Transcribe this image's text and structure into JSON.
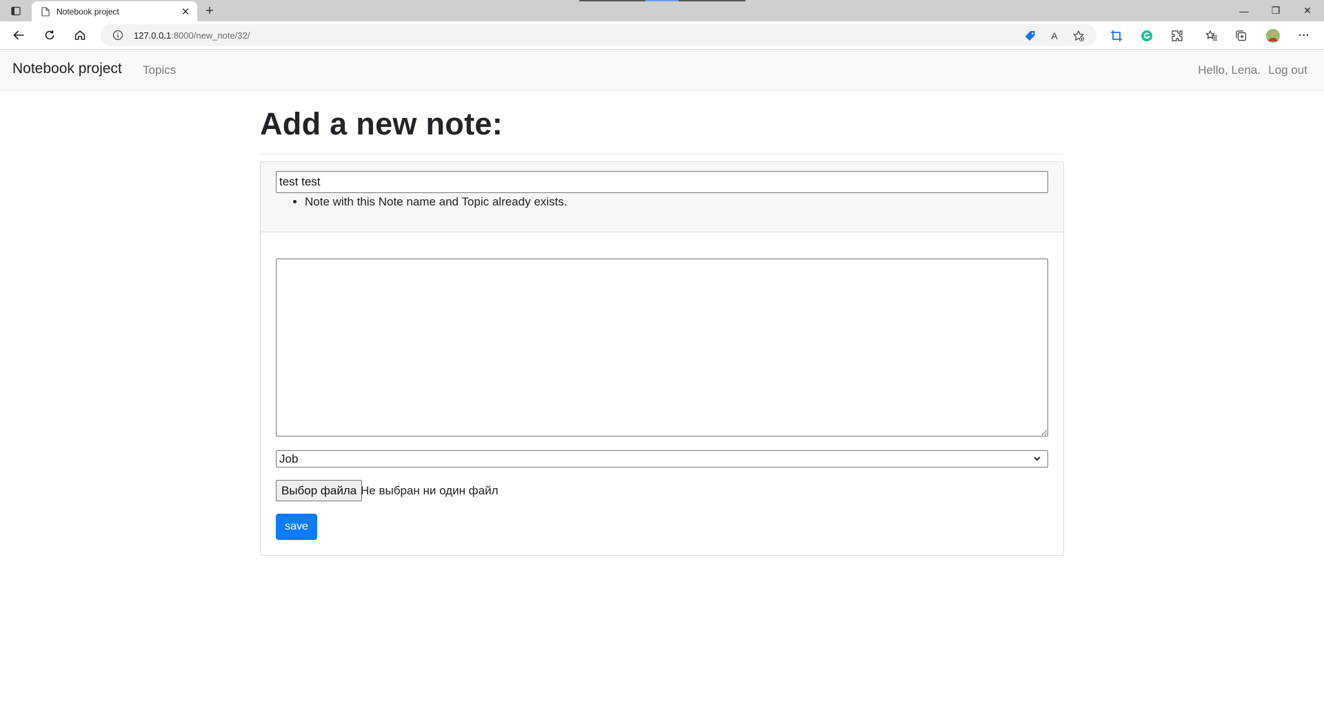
{
  "browser": {
    "tab_title": "Notebook project",
    "url_host": "127.0.0.1",
    "url_rest": ":8000/new_note/32/",
    "icons": [
      "sidebar-toggle-icon",
      "page-icon",
      "close-icon",
      "new-tab-icon",
      "back-icon",
      "reload-icon",
      "home-icon",
      "info-icon",
      "coupon-tag-icon",
      "read-aloud-icon",
      "add-favorite-icon",
      "screenshot-icon",
      "grammarly-icon",
      "extensions-icon",
      "favorites-icon",
      "collections-icon",
      "profile-avatar-icon",
      "more-icon",
      "minimize-icon",
      "restore-icon",
      "window-close-icon"
    ],
    "read_aloud_label": "A",
    "more_label": "···",
    "window": {
      "minimize": "—",
      "restore": "❐",
      "close": "✕"
    }
  },
  "navbar": {
    "brand": "Notebook project",
    "topics": "Topics",
    "greeting": "Hello, Lena.",
    "logout": "Log out"
  },
  "page": {
    "title": "Add a new note:"
  },
  "form": {
    "name_value": "test test",
    "errors": [
      "Note with this Note name and Topic already exists."
    ],
    "text_value": "",
    "topic_selected": "Job",
    "file_button": "Выбор файла",
    "file_status": "Не выбран ни один файл",
    "save_label": "save"
  },
  "colors": {
    "primary": "#0d7bfc",
    "navbar_bg": "#f8f9fa",
    "card_header_bg": "#f7f7f7"
  }
}
